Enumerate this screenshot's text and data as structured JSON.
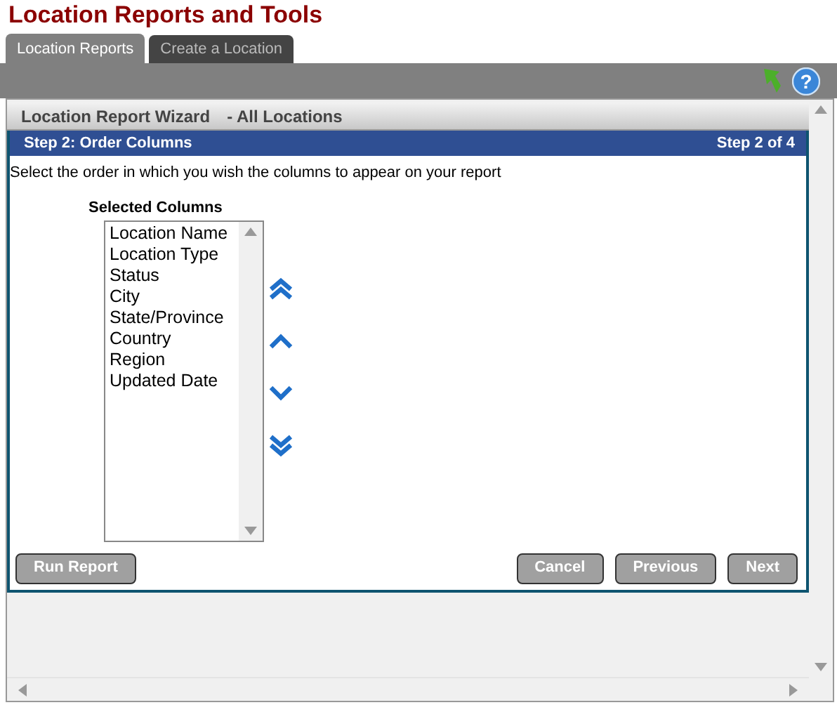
{
  "page_title": "Location Reports and Tools",
  "help_glyph": "?",
  "tabs": [
    {
      "label": "Location Reports",
      "selected": true
    },
    {
      "label": "Create a Location",
      "selected": false
    }
  ],
  "wizard": {
    "title": "Location Report Wizard",
    "subtitle": "- All Locations",
    "step_title": "Step 2: Order Columns",
    "step_counter": "Step 2 of 4",
    "instructions": "Select the order in which you wish the columns to appear on your report",
    "list_label": "Selected Columns",
    "columns": [
      "Location Name",
      "Location Type",
      "Status",
      "City",
      "State/Province",
      "Country",
      "Region",
      "Updated Date"
    ],
    "move_buttons": [
      {
        "kind": "top"
      },
      {
        "kind": "up"
      },
      {
        "kind": "down"
      },
      {
        "kind": "bottom"
      }
    ],
    "left_buttons": [
      "Run Report"
    ],
    "right_buttons": [
      "Cancel",
      "Previous",
      "Next"
    ]
  }
}
